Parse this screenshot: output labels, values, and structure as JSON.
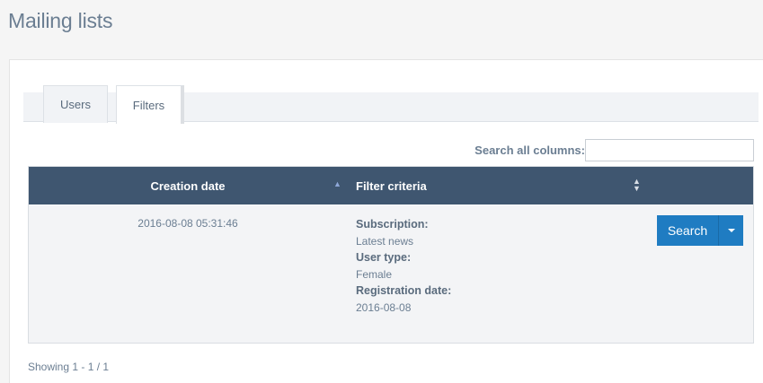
{
  "page": {
    "title": "Mailing lists"
  },
  "tabs": [
    {
      "label": "Users",
      "active": false
    },
    {
      "label": "Filters",
      "active": true
    }
  ],
  "search": {
    "label": "Search all columns:",
    "value": "",
    "placeholder": ""
  },
  "table": {
    "columns": [
      {
        "label": "Creation date",
        "sort": "asc"
      },
      {
        "label": "Filter criteria",
        "sort": "none"
      }
    ],
    "rows": [
      {
        "creation_date": "2016-08-08 05:31:46",
        "criteria": [
          {
            "key": "Subscription:",
            "value": "Latest news"
          },
          {
            "key": "User type:",
            "value": "Female"
          },
          {
            "key": "Registration date:",
            "value": "2016-08-08"
          }
        ],
        "action_label": "Search"
      }
    ]
  },
  "footer": {
    "showing": "Showing 1 - 1 / 1"
  },
  "colors": {
    "header_bg": "#3f5670",
    "button": "#1f7cc2",
    "title": "#6b7e92"
  }
}
